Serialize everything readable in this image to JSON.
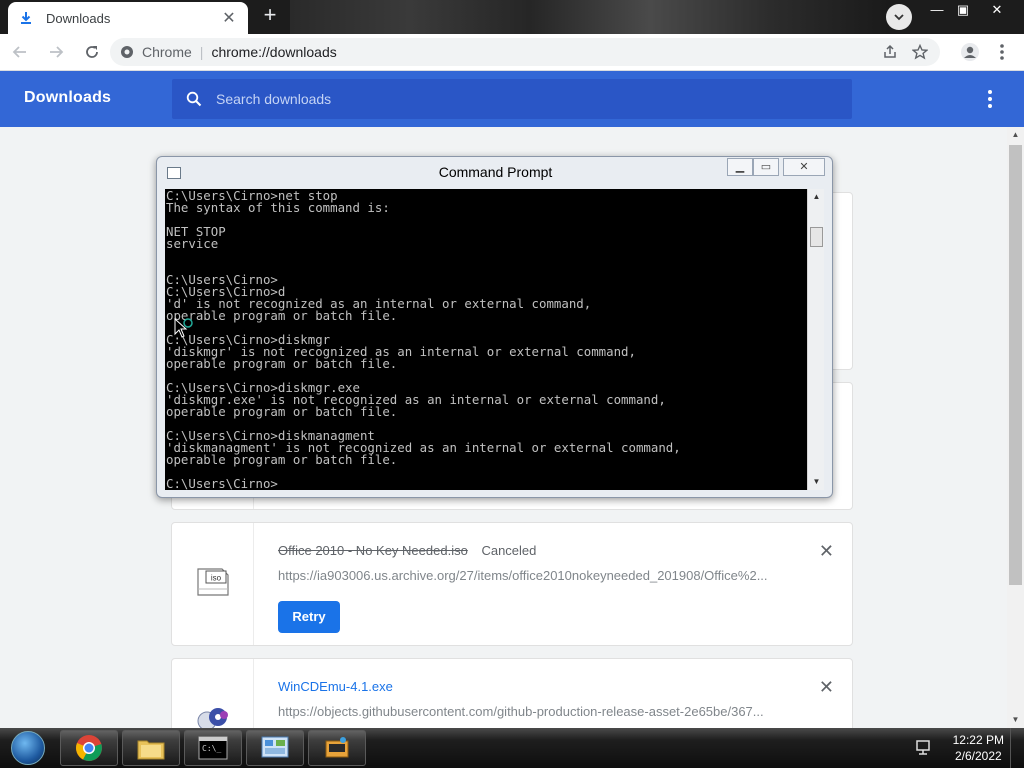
{
  "browser": {
    "tab_title": "Downloads",
    "site_label": "Chrome",
    "url": "chrome://downloads"
  },
  "downloads_page": {
    "title": "Downloads",
    "search_placeholder": "Search downloads"
  },
  "cmd": {
    "title": "Command Prompt",
    "lines": "C:\\Users\\Cirno>net stop\nThe syntax of this command is:\n\nNET STOP\nservice\n\n\nC:\\Users\\Cirno>\nC:\\Users\\Cirno>d\n'd' is not recognized as an internal or external command,\noperable program or batch file.\n\nC:\\Users\\Cirno>diskmgr\n'diskmgr' is not recognized as an internal or external command,\noperable program or batch file.\n\nC:\\Users\\Cirno>diskmgr.exe\n'diskmgr.exe' is not recognized as an internal or external command,\noperable program or batch file.\n\nC:\\Users\\Cirno>diskmanagment\n'diskmanagment' is not recognized as an internal or external command,\noperable program or batch file.\n\nC:\\Users\\Cirno>"
  },
  "items": [
    {
      "filename": "Office 2010 - No Key Needed.iso",
      "status": "Canceled",
      "url": "https://ia903006.us.archive.org/27/items/office2010nokeyneeded_201908/Office%2...",
      "action": "Retry",
      "icon": "iso-file-icon"
    },
    {
      "filename": "WinCDEmu-4.1.exe",
      "url": "https://objects.githubusercontent.com/github-production-release-asset-2e65be/367...",
      "icon": "wincdemu-icon"
    }
  ],
  "taskbar": {
    "time": "12:22 PM",
    "date": "2/6/2022",
    "apps": [
      "chrome-icon",
      "explorer-icon",
      "cmd-icon",
      "control-panel-icon",
      "wincdemu-taskbar-icon"
    ]
  },
  "colors": {
    "header_blue": "#3367d6",
    "link_blue": "#1a73e8",
    "console_bg": "#000000",
    "console_fg": "#c0c0c0"
  }
}
